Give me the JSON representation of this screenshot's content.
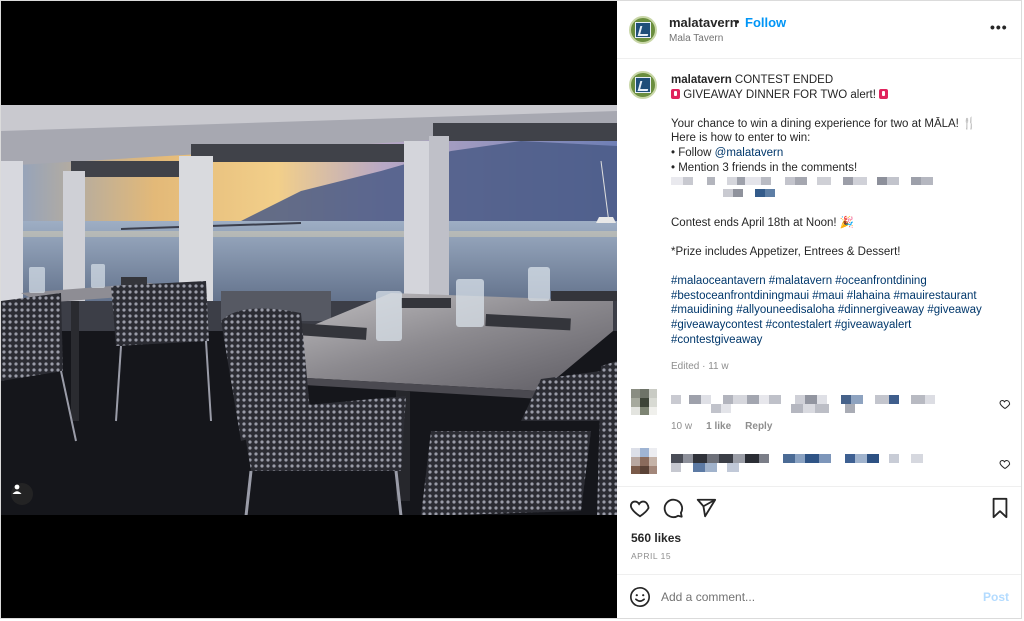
{
  "post": {
    "username": "malatavern",
    "dot": "•",
    "follow_label": "Follow",
    "subtitle": "Mala Tavern",
    "more_label": "•••"
  },
  "caption": {
    "username": "malatavern",
    "lines": [
      " CONTEST ENDED",
      " GIVEAWAY DINNER FOR TWO alert! ",
      "",
      "Your chance to win a dining experience for two at MĀLA! 🍴",
      "Here is how to enter to win:",
      "• Follow ",
      "• Mention 3 friends in the comments!",
      "",
      "Contest ends April 18th at Noon! 🎉",
      "",
      "*Prize includes Appetizer, Entrees & Dessert!"
    ],
    "mention": "@malatavern",
    "hashtag_lines": [
      "#malaoceantavern #malatavern #oceanfrontdining",
      "#bestoceanfrontdiningmaui #maui #lahaina #mauirestaurant",
      "#mauidining #allyouneedisaloha #dinnergiveaway #giveaway",
      "#giveawaycontest #contestalert #giveawayalert",
      "#contestgiveaway"
    ],
    "edited": "Edited · 11 w"
  },
  "comments": [
    {
      "time": "10 w",
      "likes": "1 like",
      "reply": "Reply"
    }
  ],
  "engagement": {
    "likes": "560 likes",
    "date": "APRIL 15"
  },
  "composer": {
    "placeholder": "Add a comment...",
    "post_label": "Post"
  },
  "icons": {
    "like": "heart-icon",
    "comment": "comment-icon",
    "share": "share-icon",
    "save": "bookmark-icon",
    "emoji": "emoji-icon",
    "tag": "user-tag-icon",
    "more": "more-options-icon"
  },
  "colors": {
    "follow": "#0095f6",
    "link": "#00376b",
    "post_disabled": "#b3dbff",
    "muted": "#737373"
  }
}
